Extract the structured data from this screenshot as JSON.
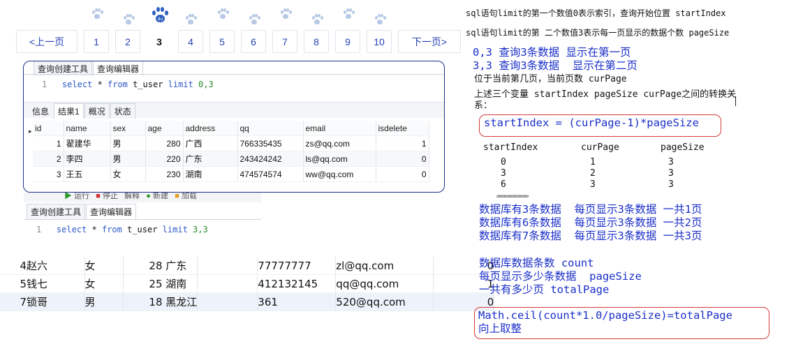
{
  "pager": {
    "prev": "<上一页",
    "next": "下一页>",
    "current": "3",
    "pages": [
      "1",
      "2",
      "3",
      "4",
      "5",
      "6",
      "7",
      "8",
      "9",
      "10"
    ],
    "logo_text": "du"
  },
  "panel1": {
    "tabs": [
      "查询创建工具",
      "查询编辑器"
    ],
    "line_no": "1",
    "sql": {
      "kw1": "select",
      "rest1": " * ",
      "kw2": "from",
      "table": " t_user ",
      "kw3": "limit",
      "args": " 0,3"
    },
    "result_tabs": [
      "信息",
      "结果1",
      "概况",
      "状态"
    ],
    "columns": [
      "id",
      "name",
      "sex",
      "age",
      "address",
      "qq",
      "email",
      "isdelete"
    ],
    "rows": [
      [
        "1",
        "翟建华",
        "男",
        "280",
        "广西",
        "766335435",
        "zs@qq.com",
        "1"
      ],
      [
        "2",
        "李四",
        "男",
        "220",
        "广东",
        "243424242",
        "ls@qq.com",
        "0"
      ],
      [
        "3",
        "王五",
        "女",
        "230",
        "湖南",
        "474574574",
        "ww@qq.com",
        "0"
      ]
    ]
  },
  "panel2": {
    "toolbar_partial": [
      "运行",
      "停止",
      "解释",
      "新建",
      "加载"
    ],
    "tabs": [
      "查询创建工具",
      "查询编辑器"
    ],
    "line_no": "1",
    "sql": {
      "kw1": "select",
      "rest1": " * ",
      "kw2": "from",
      "table": " t_user ",
      "kw3": "limit",
      "args": " 3,3"
    }
  },
  "results2": {
    "rows": [
      [
        "4",
        "赵六",
        "女",
        "28",
        "广东",
        "77777777",
        "zl@qq.com",
        "0"
      ],
      [
        "5",
        "钱七",
        "女",
        "25",
        "湖南",
        "412132145",
        "qq@qq.com",
        "1"
      ],
      [
        "7",
        "锁哥",
        "男",
        "18",
        "黑龙江",
        "361",
        "520@qq.com",
        "0"
      ]
    ]
  },
  "notes": {
    "line1": "sql语句limit的第一个数值0表示索引，查询开始位置 startIndex",
    "line2": "sql语句limit的第 二个数值3表示每一页显示的数据个数 pageSize",
    "blue1": "0,3 查询3条数据 显示在第一页",
    "blue2": "3,3 查询3条数据  显示在第二页",
    "dark1": "位于当前第几页，当前页数 curPage",
    "dark2": "上述三个变量 startIndex pageSize curPage之间的转换关",
    "dark3": "系：",
    "formula1": "startIndex = (curPage-1)*pageSize",
    "table_headers": [
      "startIndex",
      "curPage",
      "pageSize"
    ],
    "table_rows": [
      [
        "0",
        "1",
        "3"
      ],
      [
        "3",
        "2",
        "3"
      ],
      [
        "6",
        "3",
        "3"
      ]
    ],
    "dots": "。。。。。。。。。。。。。",
    "count1": "数据库有3条数据  每页显示3条数据 一共1页",
    "count2": "数据库有6条数据  每页显示3条数据 一共2页",
    "count3": "数据库有7条数据  每页显示3条数据 一共3页",
    "var1": "数据库数据条数 count",
    "var2": "每页显示多少条数据  pageSize",
    "var3": "一共有多少页 totalPage",
    "formula2": "Math.ceil(count*1.0/pageSize)=totalPage",
    "formula2_note": "向上取整"
  },
  "colors": {
    "link_blue": "#2440b3",
    "note_blue": "#1a2fc8",
    "box_red": "#d23a3a",
    "panel_border": "#1d2f8c"
  }
}
